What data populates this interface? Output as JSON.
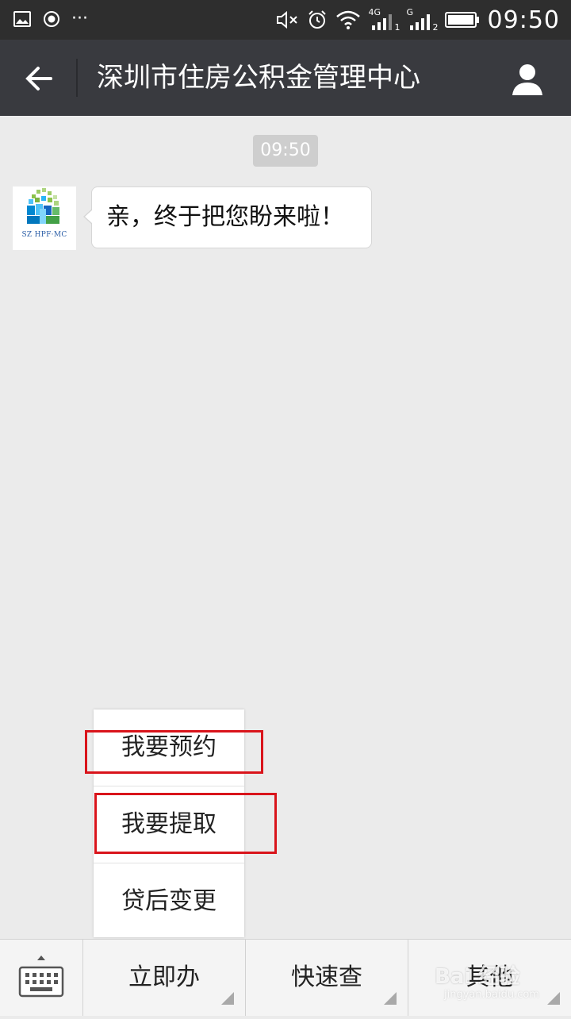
{
  "status_bar": {
    "time": "09:50",
    "network_1": "4G",
    "network_2": "G",
    "sim_1": "1",
    "sim_2": "2",
    "overflow": "···",
    "icons": [
      "gallery-icon",
      "record-icon",
      "mute-icon",
      "alarm-icon",
      "wifi-icon",
      "signal-icon",
      "battery-icon"
    ]
  },
  "header": {
    "title": "深圳市住房公积金管理中心",
    "icons": [
      "back-arrow-icon",
      "profile-icon"
    ]
  },
  "chat": {
    "timestamp": "09:50",
    "messages": [
      {
        "sender_logo_text": "SZ HPF·MC",
        "text": "亲，终于把您盼来啦！"
      }
    ]
  },
  "popup_menu": {
    "items": [
      {
        "label": "我要预约",
        "highlighted": true
      },
      {
        "label": "我要提取",
        "highlighted": true
      },
      {
        "label": "贷后变更",
        "highlighted": false
      }
    ],
    "highlight_color": "#d9141b"
  },
  "bottom_menu": {
    "keyboard_icon": "keyboard-icon",
    "items": [
      {
        "label": "立即办"
      },
      {
        "label": "快速查"
      },
      {
        "label": "其他"
      }
    ]
  },
  "watermark": {
    "text": "Bai 经验",
    "sub": "jingyan.baidu.com"
  },
  "colors": {
    "title_bar": "#393a3f",
    "status_bar": "#2e2e2e",
    "chat_background": "#ebebeb",
    "bottom_bar": "#f4f4f4"
  }
}
